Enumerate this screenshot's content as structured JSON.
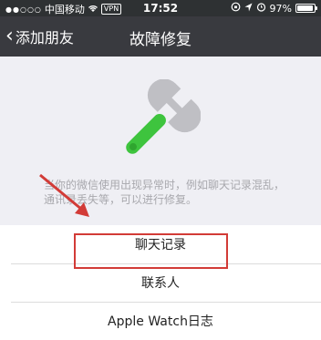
{
  "status_bar": {
    "carrier": "中国移动",
    "wifi_icon": "wifi-icon",
    "vpn": "VPN",
    "time": "17:52",
    "battery_percent": "97%",
    "battery_level": 0.97
  },
  "nav": {
    "back_label": "添加朋友",
    "title": "故障修复"
  },
  "description": "当你的微信使用出现异常时，例如聊天记录混乱，通讯录丢失等，可以进行修复。",
  "list": {
    "items": [
      {
        "label": "聊天记录"
      },
      {
        "label": "联系人"
      },
      {
        "label": "Apple Watch日志"
      }
    ]
  },
  "colors": {
    "nav_bg": "#393a3f",
    "highlight": "#d23b37",
    "wrench_green": "#3ec43e",
    "wrench_gray": "#bfbfc4"
  }
}
